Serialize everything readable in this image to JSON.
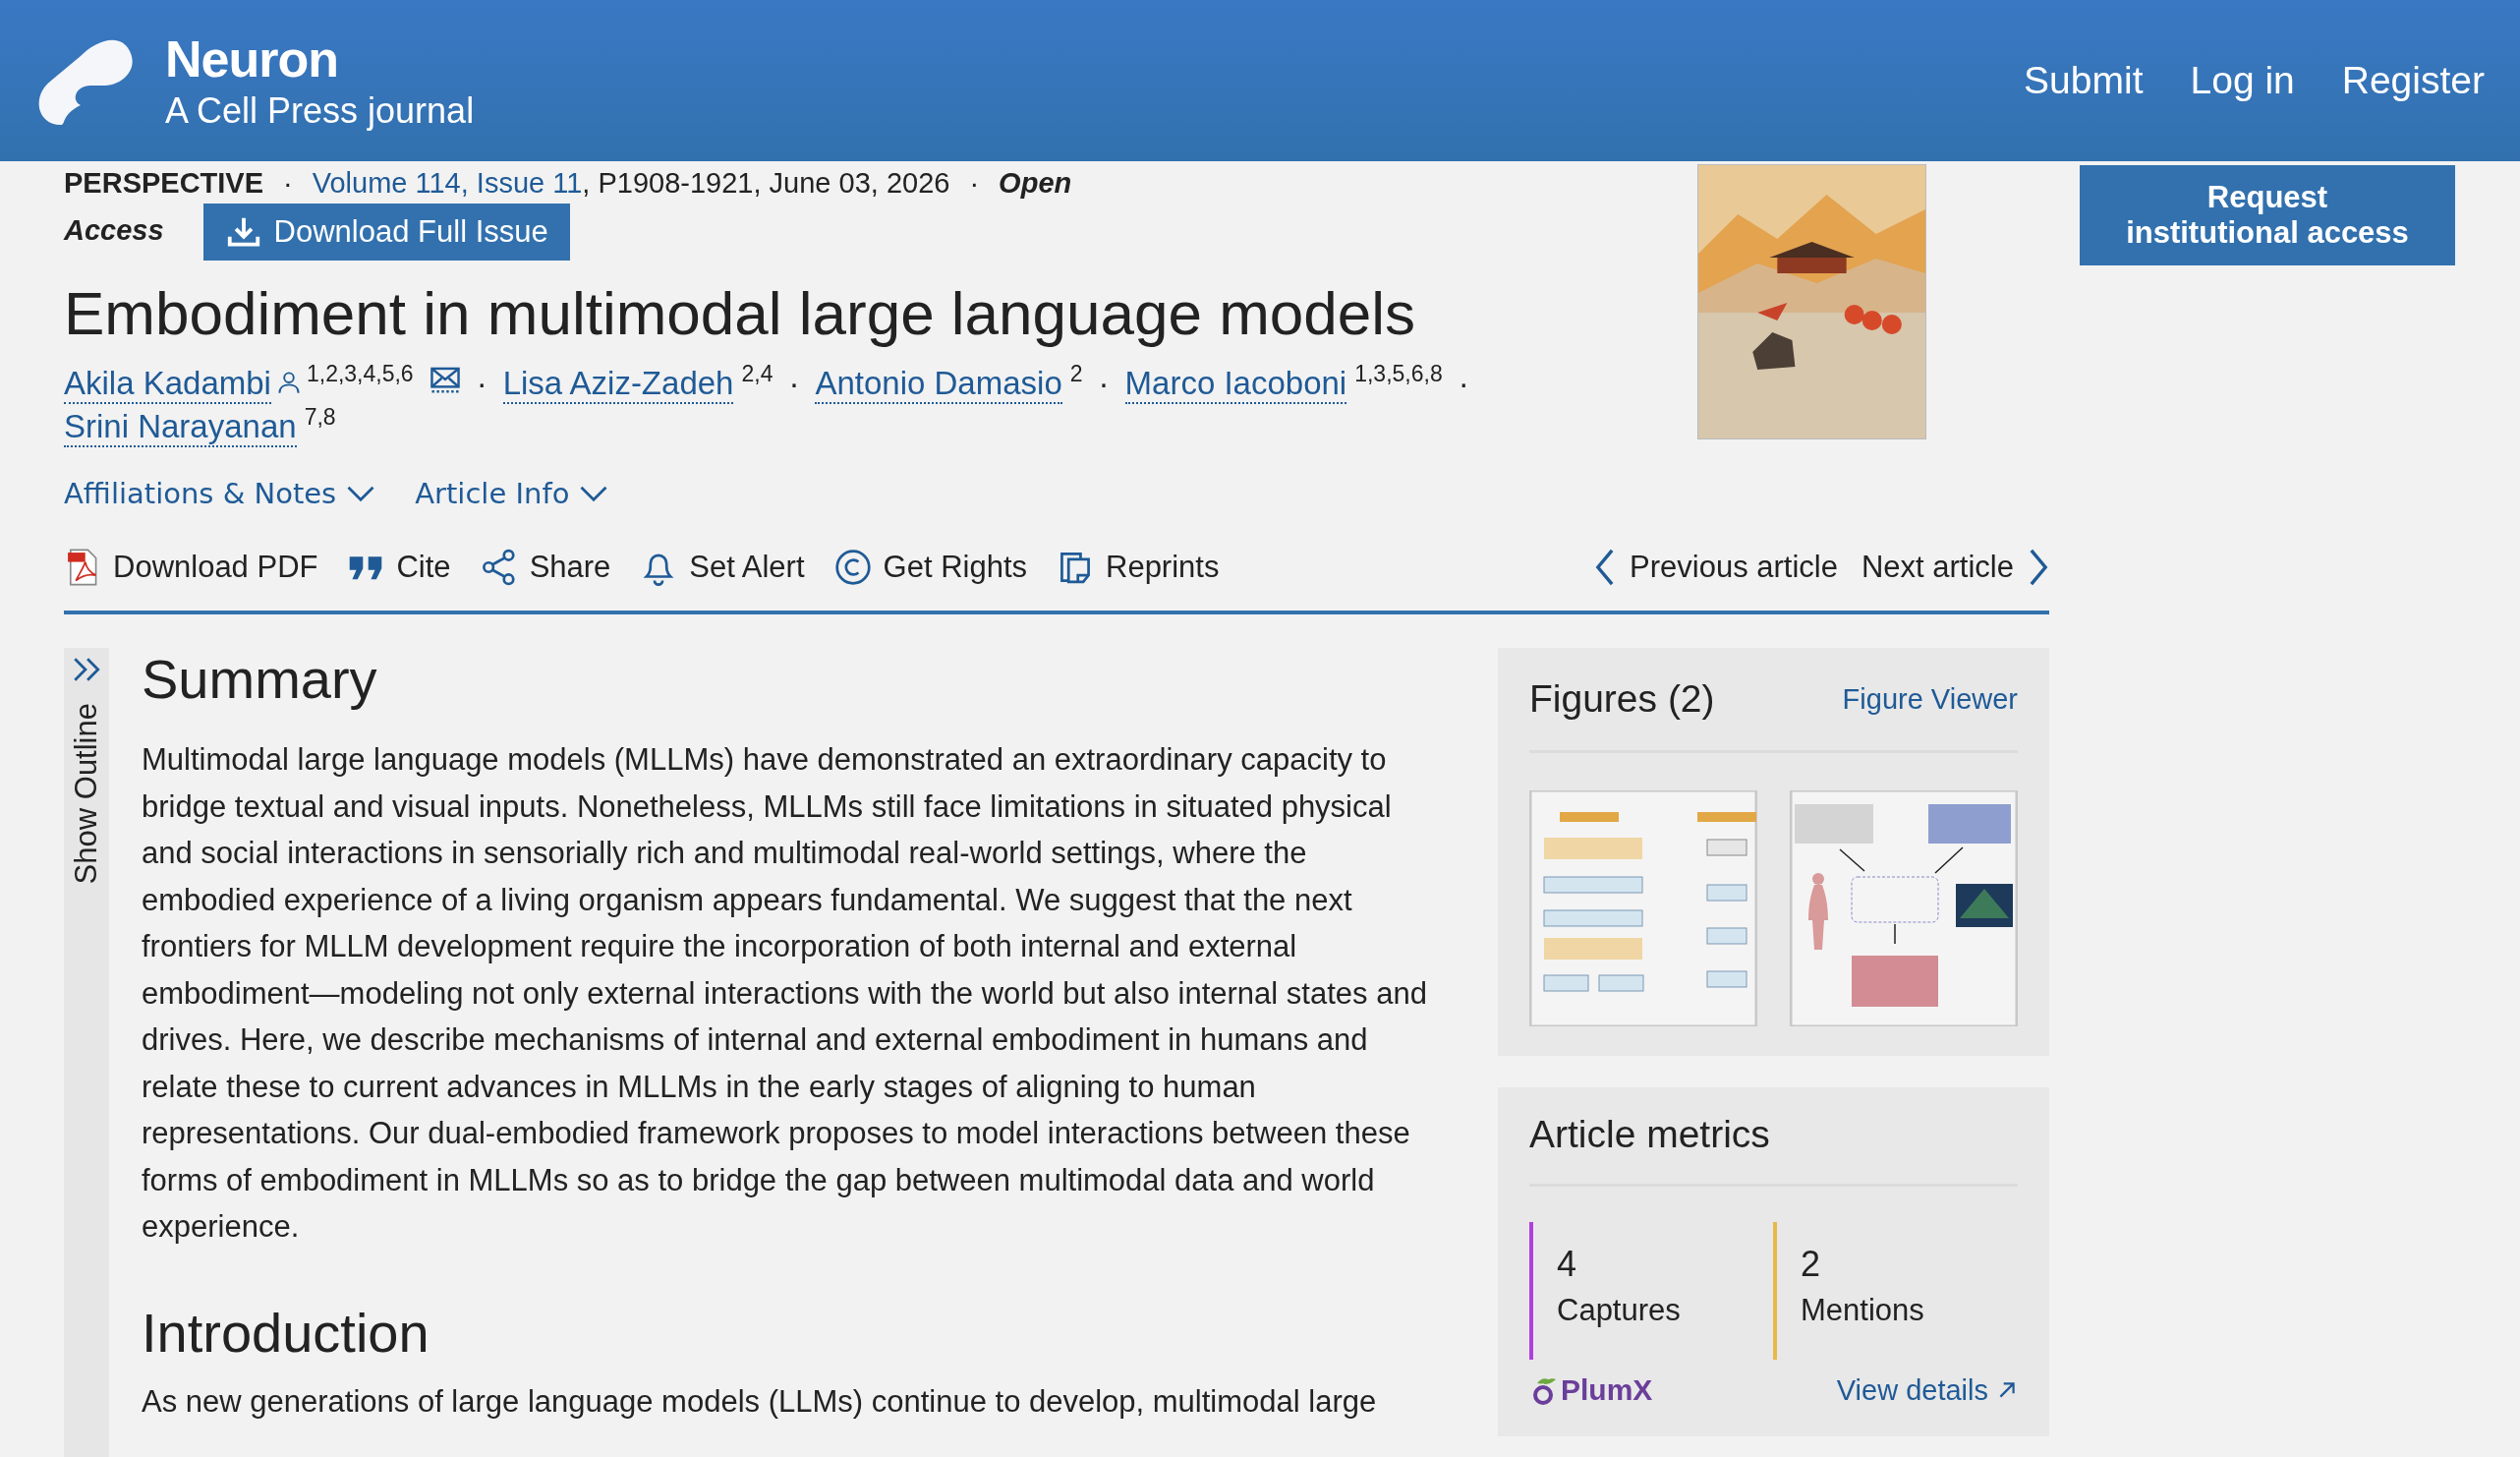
{
  "header": {
    "title": "Neuron",
    "subtitle": "A Cell Press journal",
    "nav": [
      "Submit",
      "Log in",
      "Register"
    ]
  },
  "meta": [
    {
      "kind": "type",
      "text": "PERSPECTIVE"
    },
    {
      "kind": "sep",
      "text": "·"
    },
    {
      "kind": "link",
      "text": "Volume 114, Issue 11"
    },
    {
      "kind": "plain",
      "text": ", P1908-1921, June 03, 2026"
    },
    {
      "kind": "sep",
      "text": "·"
    },
    {
      "kind": "access",
      "text": "Open"
    },
    {
      "kind": "access",
      "text": "Access"
    }
  ],
  "download_issue": "Download Full Issue",
  "cover": {
    "kind": "picture"
  },
  "request_access": [
    "Request",
    "institutional access"
  ],
  "title": "Embodiment in multimodal large language models",
  "authors": [
    {
      "name": "Akila Kadambi",
      "affiliations": "1,2,3,4,5,6",
      "corresponding": true,
      "separator": "·"
    },
    {
      "name": "Lisa Aziz-Zadeh",
      "affiliations": "2,4",
      "corresponding": false,
      "separator": "·"
    },
    {
      "name": "Antonio Damasio",
      "affiliations": "2",
      "corresponding": false,
      "separator": "·"
    },
    {
      "name": "Marco Iacoboni",
      "affiliations": "1,3,5,6,8",
      "corresponding": false,
      "separator": "·"
    },
    {
      "name": "Srini Narayanan",
      "affiliations": "7,8",
      "corresponding": false
    }
  ],
  "toggles": [
    {
      "label": "Affiliations & Notes",
      "expanded": false
    },
    {
      "label": "Article Info",
      "expanded": false
    }
  ],
  "actions": [
    {
      "kind": "pdf",
      "label": "Download PDF"
    },
    {
      "kind": "cite",
      "label": "Cite"
    },
    {
      "kind": "share",
      "label": "Share"
    },
    {
      "kind": "alert",
      "label": "Set Alert"
    },
    {
      "kind": "rights",
      "label": "Get Rights"
    },
    {
      "kind": "reprints",
      "label": "Reprints"
    }
  ],
  "article_nav": {
    "previous": "Previous article",
    "next": "Next article"
  },
  "outline": {
    "label": "Show Outline",
    "expanded": false
  },
  "summary": {
    "heading": "Summary",
    "text": "Multimodal large language models (MLLMs) have demonstrated an extraordinary capacity to bridge textual and visual inputs. Nonetheless, MLLMs still face limitations in situated physical and social interactions in sensorially rich and multimodal real-world settings, where the embodied experience of a living organism appears fundamental. We suggest that the next frontiers for MLLM development require the incorporation of both internal and external embodiment—modeling not only external interactions with the world but also internal states and drives. Here, we describe mechanisms of internal and external embodiment in humans and relate these to current advances in MLLMs in the early stages of aligning to human representations. Our dual-embodied framework proposes to model interactions between these forms of embodiment in MLLMs so as to bridge the gap between multimodal data and world experience."
  },
  "introduction": {
    "heading": "Introduction",
    "text": "As new generations of large language models (LLMs) continue to develop, multimodal large"
  },
  "figures": {
    "title": "Figures (2)",
    "viewer_link": "Figure Viewer",
    "thumbnails": [
      {
        "kind": "picture"
      },
      {
        "kind": "picture"
      }
    ]
  },
  "metrics": {
    "title": "Article metrics",
    "items": [
      {
        "value": "4",
        "label": "Captures",
        "color": "#b040e0"
      },
      {
        "value": "2",
        "label": "Mentions",
        "color": "#e8b84a"
      }
    ],
    "provider": "PlumX",
    "details_link": "View details"
  }
}
